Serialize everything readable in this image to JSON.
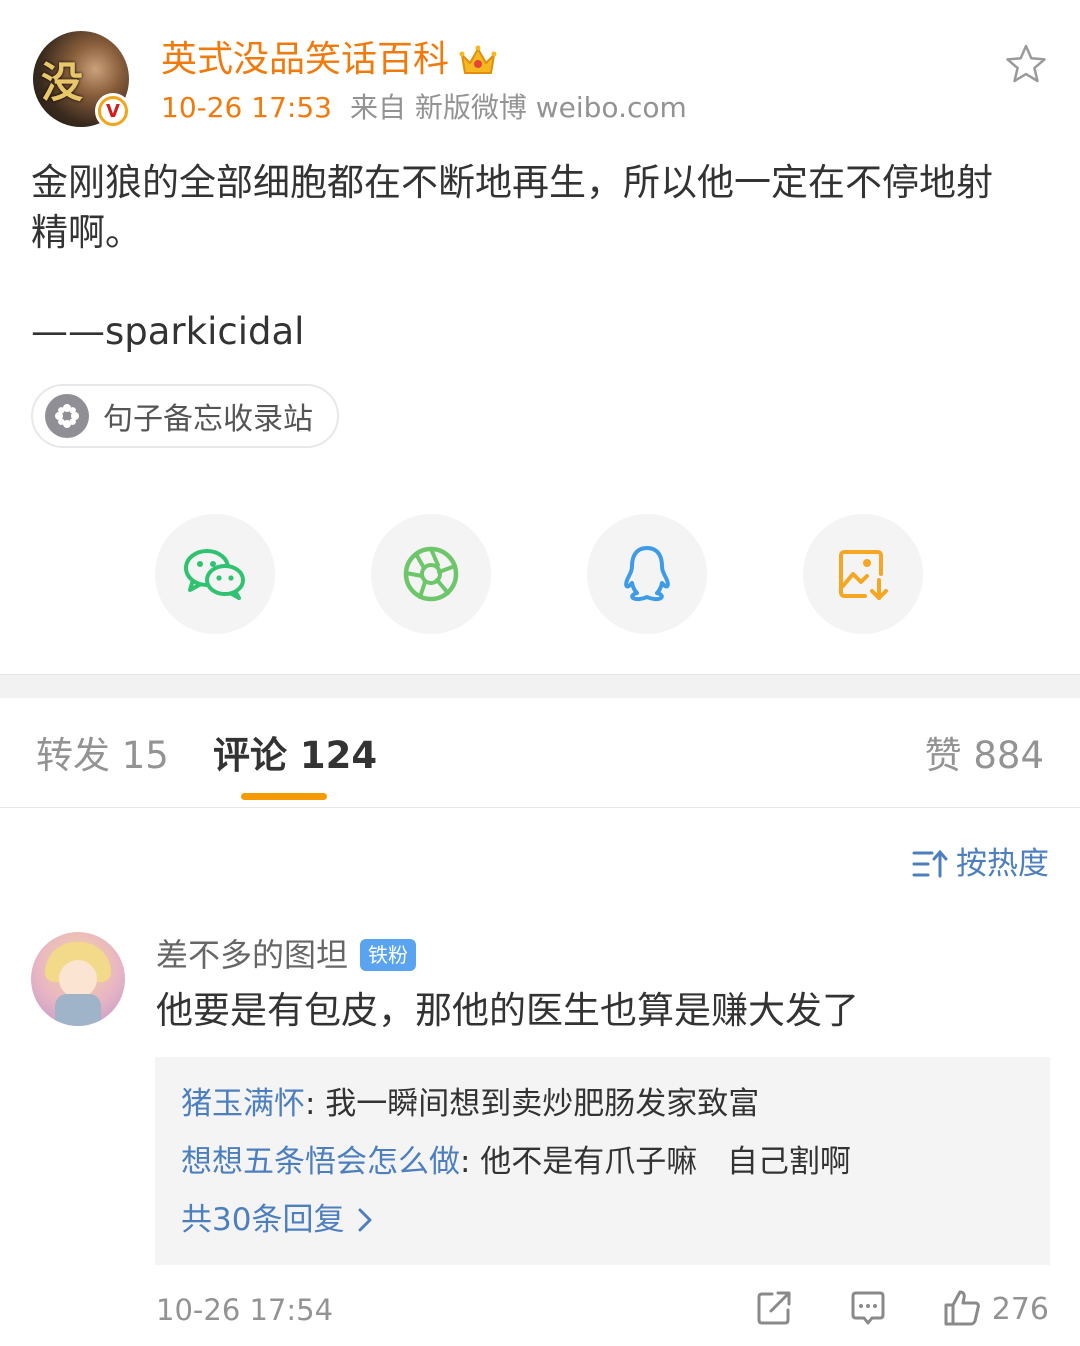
{
  "post": {
    "author_name": "英式没品笑话百科",
    "avatar_text": "没",
    "verified_badge": "V",
    "time": "10-26 17:53",
    "source": "来自 新版微博 weibo.com",
    "text": "金刚狼的全部细胞都在不断地再生，所以他一定在不停地射\n精啊。",
    "signature": "——sparkicidal",
    "topic_chip": "句子备忘收录站"
  },
  "icons": {
    "favorite": "star-outline-icon",
    "crown": "crown-icon",
    "share": [
      "wechat-icon",
      "moments-icon",
      "qq-icon",
      "save-image-icon"
    ]
  },
  "colors": {
    "accent_orange": "#f07b0c",
    "tab_indicator": "#f59a00",
    "link_blue": "#4d7fbf",
    "wechat_green": "#2fc271",
    "moments_green": "#6dc66a",
    "qq_blue": "#3d9be8",
    "save_orange": "#f5a623"
  },
  "tabs": {
    "repost": "转发 15",
    "comments": "评论 124",
    "likes": "赞 884"
  },
  "sort_label": "按热度",
  "comment": {
    "user": "差不多的图坦",
    "badge": "铁粉",
    "text": "他要是有包皮，那他的医生也算是赚大发了",
    "replies": [
      {
        "user": "猪玉满怀",
        "text": ": 我一瞬间想到卖炒肥肠发家致富"
      },
      {
        "user": "想想五条悟会怎么做",
        "text": ": 他不是有爪子嘛   自己割啊"
      }
    ],
    "more_replies": "共30条回复",
    "time": "10-26 17:54",
    "like_count": "276"
  }
}
